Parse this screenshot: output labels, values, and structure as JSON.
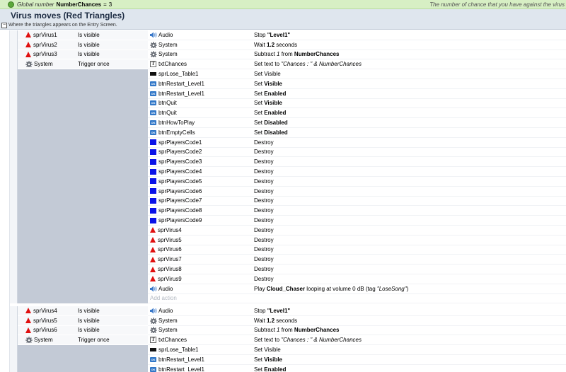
{
  "global_var": {
    "label": "Global number",
    "name": "NumberChances",
    "eq": "=",
    "value": "3",
    "comment": "The number of chance that you have against the virus"
  },
  "group": {
    "title": "Virus moves (Red Triangles)",
    "toggle": "−",
    "description": "Where the triangles appears on the Entry Screen."
  },
  "event1": {
    "conditions": [
      {
        "icon": "tri",
        "object": "sprVirus1",
        "text": "Is visible"
      },
      {
        "icon": "tri",
        "object": "sprVirus2",
        "text": "Is visible"
      },
      {
        "icon": "tri",
        "object": "sprVirus3",
        "text": "Is visible"
      },
      {
        "icon": "gear",
        "object": "System",
        "text": "Trigger once"
      }
    ],
    "actions": [
      {
        "icon": "audio",
        "object": "Audio",
        "pre": "Stop ",
        "b": "\"Level1\"",
        "post": ""
      },
      {
        "icon": "gear",
        "object": "System",
        "pre": "Wait ",
        "b": "1.2",
        "post": " seconds"
      },
      {
        "icon": "gear",
        "object": "System",
        "pre": "Subtract ",
        "i": "1",
        "mid": " from ",
        "b": "NumberChances",
        "post": ""
      },
      {
        "icon": "text",
        "object": "txtChances",
        "pre": "Set text to ",
        "i": "\"Chances : \" & NumberChances",
        "post": ""
      },
      {
        "icon": "black",
        "object": "sprLose_Table1",
        "pre": "Set Visible",
        "post": ""
      },
      {
        "icon": "btn",
        "object": "btnRestart_Level1",
        "pre": "Set ",
        "b": "Visible",
        "post": ""
      },
      {
        "icon": "btn",
        "object": "btnRestart_Level1",
        "pre": "Set ",
        "b": "Enabled",
        "post": ""
      },
      {
        "icon": "btn",
        "object": "btnQuit",
        "pre": "Set ",
        "b": "Visible",
        "post": ""
      },
      {
        "icon": "btn",
        "object": "btnQuit",
        "pre": "Set ",
        "b": "Enabled",
        "post": ""
      },
      {
        "icon": "btn",
        "object": "btnHowToPlay",
        "pre": "Set ",
        "b": "Disabled",
        "post": ""
      },
      {
        "icon": "btn",
        "object": "btnEmptyCells",
        "pre": "Set ",
        "b": "Disabled",
        "post": ""
      },
      {
        "icon": "sq",
        "object": "sprPlayersCode1",
        "pre": "Destroy",
        "post": ""
      },
      {
        "icon": "sq",
        "object": "sprPlayersCode2",
        "pre": "Destroy",
        "post": ""
      },
      {
        "icon": "sq",
        "object": "sprPlayersCode3",
        "pre": "Destroy",
        "post": ""
      },
      {
        "icon": "sq",
        "object": "sprPlayersCode4",
        "pre": "Destroy",
        "post": ""
      },
      {
        "icon": "sq",
        "object": "sprPlayersCode5",
        "pre": "Destroy",
        "post": ""
      },
      {
        "icon": "sq",
        "object": "sprPlayersCode6",
        "pre": "Destroy",
        "post": ""
      },
      {
        "icon": "sq",
        "object": "sprPlayersCode7",
        "pre": "Destroy",
        "post": ""
      },
      {
        "icon": "sq",
        "object": "sprPlayersCode8",
        "pre": "Destroy",
        "post": ""
      },
      {
        "icon": "sq",
        "object": "sprPlayersCode9",
        "pre": "Destroy",
        "post": ""
      },
      {
        "icon": "tri",
        "object": "sprVirus4",
        "pre": "Destroy",
        "post": ""
      },
      {
        "icon": "tri",
        "object": "sprVirus5",
        "pre": "Destroy",
        "post": ""
      },
      {
        "icon": "tri",
        "object": "sprVirus6",
        "pre": "Destroy",
        "post": ""
      },
      {
        "icon": "tri",
        "object": "sprVirus7",
        "pre": "Destroy",
        "post": ""
      },
      {
        "icon": "tri",
        "object": "sprVirus8",
        "pre": "Destroy",
        "post": ""
      },
      {
        "icon": "tri",
        "object": "sprVirus9",
        "pre": "Destroy",
        "post": ""
      },
      {
        "icon": "audio",
        "object": "Audio",
        "pre": "Play ",
        "b": "Cloud_Chaser",
        "mid2": " looping at volume 0 dB (tag ",
        "i2": "\"LoseSong\"",
        "post": ")"
      }
    ],
    "add_action": "Add action"
  },
  "event2": {
    "conditions": [
      {
        "icon": "tri",
        "object": "sprVirus4",
        "text": "Is visible"
      },
      {
        "icon": "tri",
        "object": "sprVirus5",
        "text": "Is visible"
      },
      {
        "icon": "tri",
        "object": "sprVirus6",
        "text": "Is visible"
      },
      {
        "icon": "gear",
        "object": "System",
        "text": "Trigger once"
      }
    ],
    "actions": [
      {
        "icon": "audio",
        "object": "Audio",
        "pre": "Stop ",
        "b": "\"Level1\"",
        "post": ""
      },
      {
        "icon": "gear",
        "object": "System",
        "pre": "Wait ",
        "b": "1.2",
        "post": " seconds"
      },
      {
        "icon": "gear",
        "object": "System",
        "pre": "Subtract ",
        "i": "1",
        "mid": " from ",
        "b": "NumberChances",
        "post": ""
      },
      {
        "icon": "text",
        "object": "txtChances",
        "pre": "Set text to ",
        "i": "\"Chances : \" & NumberChances",
        "post": ""
      },
      {
        "icon": "black",
        "object": "sprLose_Table1",
        "pre": "Set Visible",
        "post": ""
      },
      {
        "icon": "btn",
        "object": "btnRestart_Level1",
        "pre": "Set ",
        "b": "Visible",
        "post": ""
      },
      {
        "icon": "btn",
        "object": "btnRestart_Level1",
        "pre": "Set ",
        "b": "Enabled",
        "post": ""
      }
    ]
  },
  "icon_names": {
    "tri": "red-triangle-sprite-icon",
    "sq": "blue-square-sprite-icon",
    "black": "black-bar-sprite-icon",
    "btn": "button-object-icon",
    "text": "text-object-icon",
    "audio": "audio-speaker-icon",
    "gear": "system-gear-icon"
  },
  "colors": {
    "virus_red": "#e01010",
    "code_blue": "#0a12e8",
    "button_blue": "#2f76c7",
    "global_bar": "#d7efc4",
    "group_bar": "#dfe6ee"
  }
}
